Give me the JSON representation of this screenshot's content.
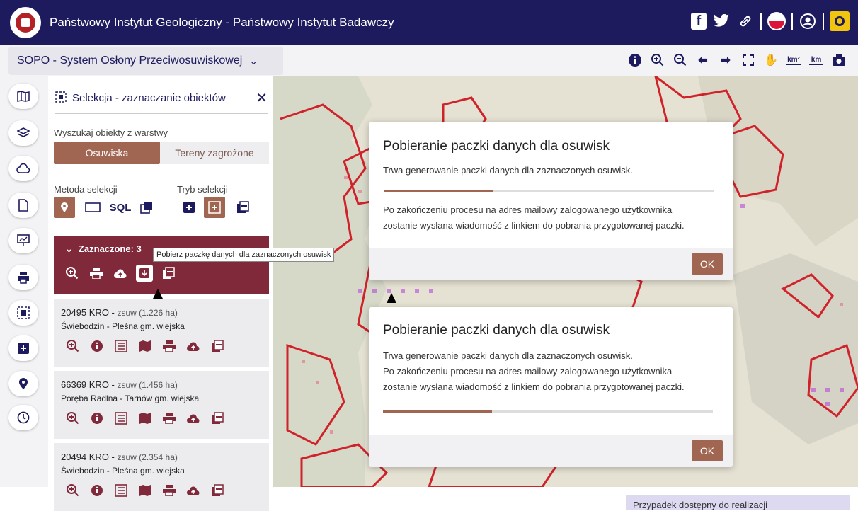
{
  "header": {
    "title": "Państwowy Instytut Geologiczny - Państwowy Instytut Badawczy"
  },
  "system": {
    "name": "SOPO - System Osłony Przeciwosuwiskowej"
  },
  "panel": {
    "title": "Selekcja - zaznaczanie obiektów",
    "search_label": "Wyszukaj obiekty z warstwy",
    "tab_active": "Osuwiska",
    "tab_inactive": "Tereny zagrożone",
    "method_label": "Metoda selekcji",
    "mode_label": "Tryb selekcji",
    "sql_label": "SQL",
    "selected_label": "Zaznaczone: 3",
    "tooltip": "Pobierz paczkę danych dla zaznaczonych osuwisk"
  },
  "results": [
    {
      "id": "20495 KRO",
      "desc": "zsuw (1.226 ha)",
      "place": "Świebodzin - Pleśna gm. wiejska"
    },
    {
      "id": "66369 KRO",
      "desc": "zsuw (1.456 ha)",
      "place": "Poręba Radlna - Tarnów gm. wiejska"
    },
    {
      "id": "20494 KRO",
      "desc": "zsuw (2.354 ha)",
      "place": "Świebodzin - Pleśna gm. wiejska"
    }
  ],
  "modal1": {
    "title": "Pobieranie paczki danych dla osuwisk",
    "line1": "Trwa generowanie paczki danych dla zaznaczonych osuwisk.",
    "line2": "Po zakończeniu procesu na adres mailowy zalogowanego użytkownika",
    "line3": "zostanie wysłana wiadomość z linkiem do pobrania przygotowanej paczki.",
    "ok": "OK",
    "progress": 0.33
  },
  "modal2": {
    "title": "Pobieranie paczki danych dla osuwisk",
    "line1": "Trwa generowanie paczki danych dla zaznaczonych osuwisk.",
    "line2": "Po zakończeniu procesu na adres mailowy zalogowanego użytkownika",
    "line3": "zostanie wysłana wiadomość z linkiem do pobrania przygotowanej paczki.",
    "ok": "OK",
    "progress": 0.33
  },
  "toolbar": {
    "km2": "km²",
    "km": "km"
  },
  "note": "Przypadek dostępny do realizacji",
  "colors": {
    "primary": "#1d1a5e",
    "accent": "#a16651",
    "selection": "#80293a"
  }
}
